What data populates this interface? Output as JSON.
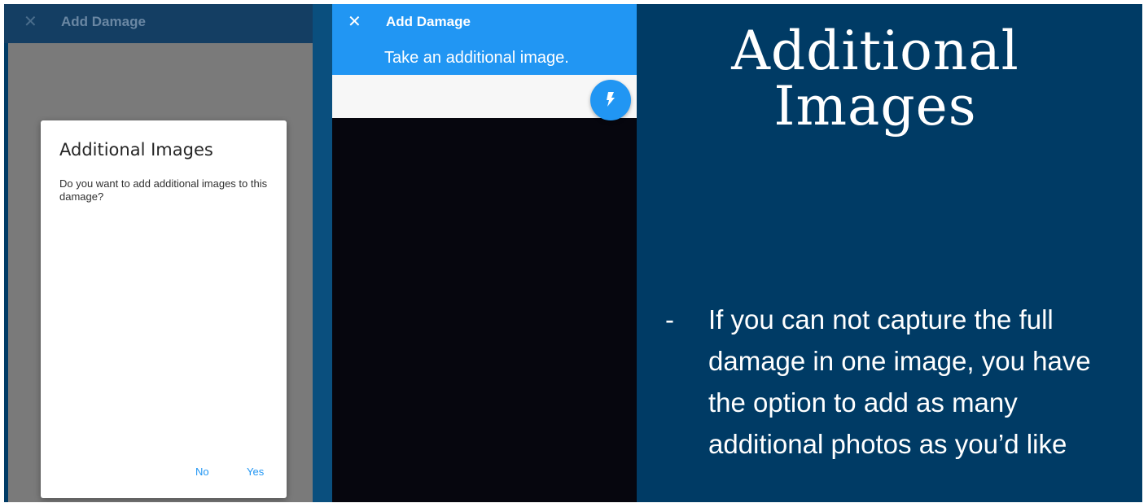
{
  "phone_left": {
    "appbar": {
      "close_icon": "close-icon",
      "title": "Add Damage"
    },
    "dialog": {
      "title": "Additional Images",
      "message": "Do you want to add additional images to this damage?",
      "buttons": {
        "no": "No",
        "yes": "Yes"
      }
    }
  },
  "phone_right": {
    "appbar": {
      "close_icon": "close-icon",
      "title": "Add Damage",
      "subtitle": "Take an additional image."
    },
    "flash_icon": "flash-icon"
  },
  "slide": {
    "title": "Additional Images",
    "bullet_marker": "-",
    "bullet_text": "If you can not capture the full damage in one image, you have the option to add as many additional photos as you’d like"
  },
  "colors": {
    "slide_background": "#003b65",
    "accent_blue": "#2196f3",
    "dim_overlay": "#7a7a7a",
    "camera_background": "#06060e"
  }
}
